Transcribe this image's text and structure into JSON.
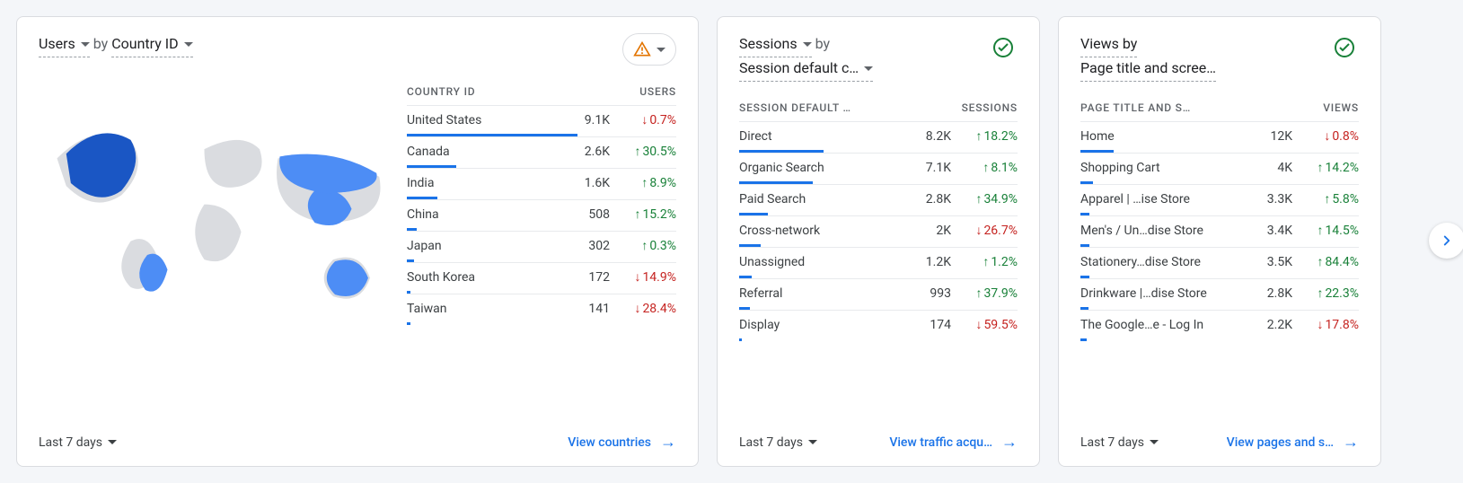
{
  "period_label": "Last 7 days",
  "card1": {
    "metric": "Users",
    "by": "by",
    "dimension": "Country ID",
    "status": "warning",
    "table_header_left": "COUNTRY ID",
    "table_header_right": "USERS",
    "rows": [
      {
        "label": "United States",
        "value": "9.1K",
        "delta": "0.7%",
        "dir": "down",
        "bar": 100
      },
      {
        "label": "Canada",
        "value": "2.6K",
        "delta": "30.5%",
        "dir": "up",
        "bar": 29
      },
      {
        "label": "India",
        "value": "1.6K",
        "delta": "8.9%",
        "dir": "up",
        "bar": 18
      },
      {
        "label": "China",
        "value": "508",
        "delta": "15.2%",
        "dir": "up",
        "bar": 6
      },
      {
        "label": "Japan",
        "value": "302",
        "delta": "0.3%",
        "dir": "up",
        "bar": 4
      },
      {
        "label": "South Korea",
        "value": "172",
        "delta": "14.9%",
        "dir": "down",
        "bar": 2
      },
      {
        "label": "Taiwan",
        "value": "141",
        "delta": "28.4%",
        "dir": "down",
        "bar": 2
      }
    ],
    "view_link": "View countries"
  },
  "card2": {
    "metric": "Sessions",
    "by": "by",
    "dimension": "Session default c…",
    "status": "ok",
    "table_header_left": "SESSION DEFAULT …",
    "table_header_right": "SESSIONS",
    "rows": [
      {
        "label": "Direct",
        "value": "8.2K",
        "delta": "18.2%",
        "dir": "up",
        "bar": 55
      },
      {
        "label": "Organic Search",
        "value": "7.1K",
        "delta": "8.1%",
        "dir": "up",
        "bar": 48
      },
      {
        "label": "Paid Search",
        "value": "2.8K",
        "delta": "34.9%",
        "dir": "up",
        "bar": 19
      },
      {
        "label": "Cross-network",
        "value": "2K",
        "delta": "26.7%",
        "dir": "down",
        "bar": 14
      },
      {
        "label": "Unassigned",
        "value": "1.2K",
        "delta": "1.2%",
        "dir": "up",
        "bar": 8
      },
      {
        "label": "Referral",
        "value": "993",
        "delta": "37.9%",
        "dir": "up",
        "bar": 7
      },
      {
        "label": "Display",
        "value": "174",
        "delta": "59.5%",
        "dir": "down",
        "bar": 2
      }
    ],
    "view_link": "View traffic acqu…"
  },
  "card3": {
    "prefix": "Views by",
    "dimension": "Page title and scree…",
    "status": "ok",
    "table_header_left": "PAGE TITLE AND S…",
    "table_header_right": "VIEWS",
    "rows": [
      {
        "label": "Home",
        "value": "12K",
        "delta": "0.8%",
        "dir": "down",
        "bar": 22
      },
      {
        "label": "Shopping Cart",
        "value": "4K",
        "delta": "14.2%",
        "dir": "up",
        "bar": 8
      },
      {
        "label": "Apparel | …ise Store",
        "value": "3.3K",
        "delta": "5.8%",
        "dir": "up",
        "bar": 6
      },
      {
        "label": "Men's / Un…dise Store",
        "value": "3.4K",
        "delta": "14.5%",
        "dir": "up",
        "bar": 6
      },
      {
        "label": "Stationery…dise Store",
        "value": "3.5K",
        "delta": "84.4%",
        "dir": "up",
        "bar": 6
      },
      {
        "label": "Drinkware |…dise Store",
        "value": "2.8K",
        "delta": "22.3%",
        "dir": "up",
        "bar": 5
      },
      {
        "label": "The Google…e - Log In",
        "value": "2.2K",
        "delta": "17.8%",
        "dir": "down",
        "bar": 4
      }
    ],
    "view_link": "View pages and s…"
  },
  "chart_data": [
    {
      "type": "table",
      "title": "Users by Country ID",
      "categories": [
        "United States",
        "Canada",
        "India",
        "China",
        "Japan",
        "South Korea",
        "Taiwan"
      ],
      "series": [
        {
          "name": "Users",
          "values": [
            9100,
            2600,
            1600,
            508,
            302,
            172,
            141
          ]
        },
        {
          "name": "Change %",
          "values": [
            -0.7,
            30.5,
            8.9,
            15.2,
            0.3,
            -14.9,
            -28.4
          ]
        }
      ]
    },
    {
      "type": "table",
      "title": "Sessions by Session default channel group",
      "categories": [
        "Direct",
        "Organic Search",
        "Paid Search",
        "Cross-network",
        "Unassigned",
        "Referral",
        "Display"
      ],
      "series": [
        {
          "name": "Sessions",
          "values": [
            8200,
            7100,
            2800,
            2000,
            1200,
            993,
            174
          ]
        },
        {
          "name": "Change %",
          "values": [
            18.2,
            8.1,
            34.9,
            -26.7,
            1.2,
            37.9,
            -59.5
          ]
        }
      ]
    },
    {
      "type": "table",
      "title": "Views by Page title and screen name",
      "categories": [
        "Home",
        "Shopping Cart",
        "Apparel | …ise Store",
        "Men's / Un…dise Store",
        "Stationery…dise Store",
        "Drinkware |…dise Store",
        "The Google…e - Log In"
      ],
      "series": [
        {
          "name": "Views",
          "values": [
            12000,
            4000,
            3300,
            3400,
            3500,
            2800,
            2200
          ]
        },
        {
          "name": "Change %",
          "values": [
            -0.8,
            14.2,
            5.8,
            14.5,
            84.4,
            22.3,
            -17.8
          ]
        }
      ]
    }
  ]
}
